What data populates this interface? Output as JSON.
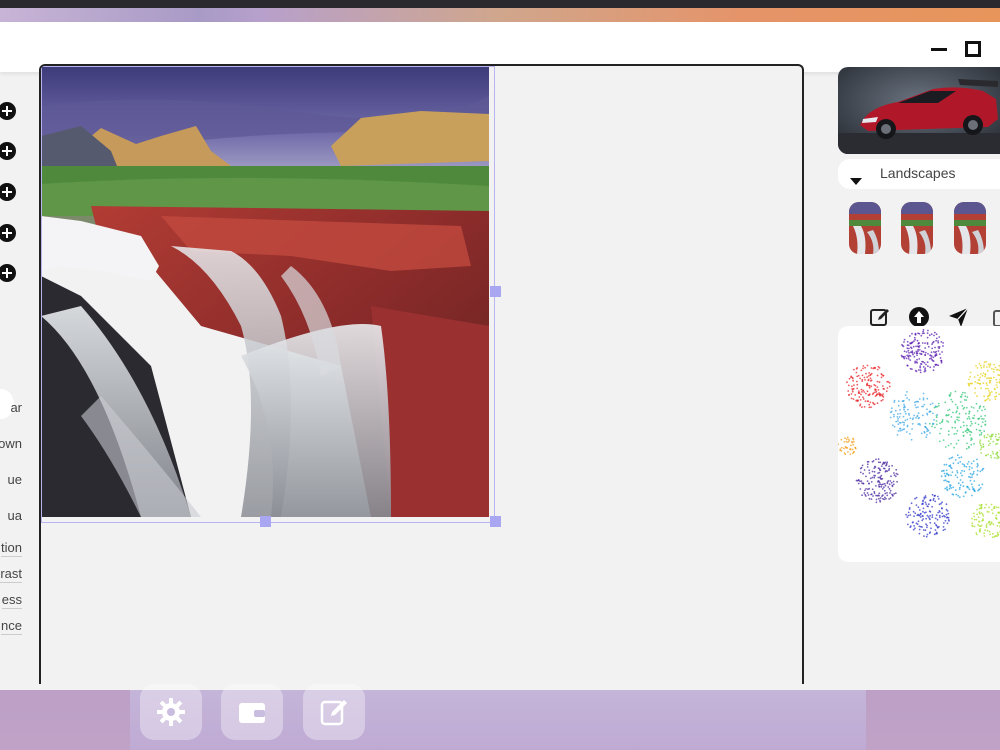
{
  "left_panel": {
    "labels": [
      "ar",
      "own",
      "ue",
      "ua",
      "tion",
      "rast",
      "ess",
      "nce"
    ]
  },
  "right_panel": {
    "category_select": {
      "value": "Landscapes"
    }
  },
  "colors": {
    "accent_selection": "#a9a6f2",
    "window_bg": "#f2f2f2"
  },
  "icons": {
    "dock": [
      "gear-icon",
      "wallet-icon",
      "edit-icon"
    ],
    "tools": [
      "edit-icon",
      "upload-icon",
      "send-icon",
      "calendar-icon"
    ]
  }
}
